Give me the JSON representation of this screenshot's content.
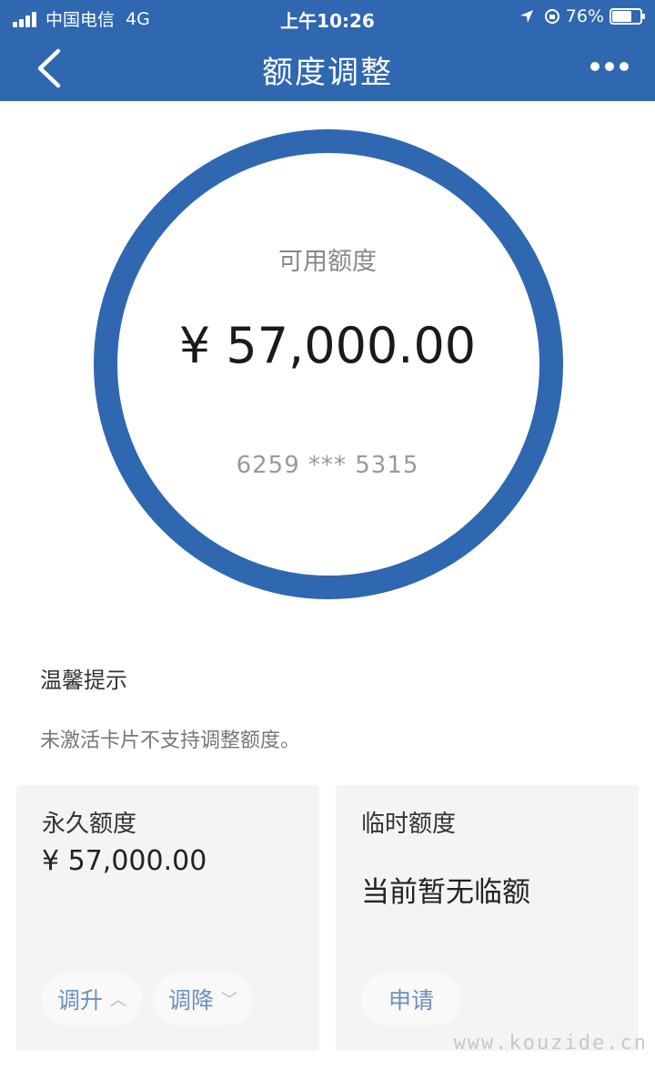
{
  "status_bar": {
    "carrier": "中国电信",
    "network": "4G",
    "time": "上午10:26",
    "battery": "76%",
    "battery_level": 0.76
  },
  "nav": {
    "title": "额度调整"
  },
  "credit_ring": {
    "label": "可用额度",
    "amount": "¥ 57,000.00",
    "card_number": "6259 *** 5315"
  },
  "tip": {
    "title": "温馨提示",
    "text": "未激活卡片不支持调整额度。"
  },
  "permanent": {
    "title": "永久额度",
    "amount": "¥  57,000.00",
    "increase_label": "调升",
    "decrease_label": "调降"
  },
  "temporary": {
    "title": "临时额度",
    "message": "当前暂无临额",
    "apply_label": "申请"
  },
  "watermark": "www.kouzide.cn",
  "colors": {
    "brand": "#2f67b1",
    "link": "#6f8fbf"
  }
}
